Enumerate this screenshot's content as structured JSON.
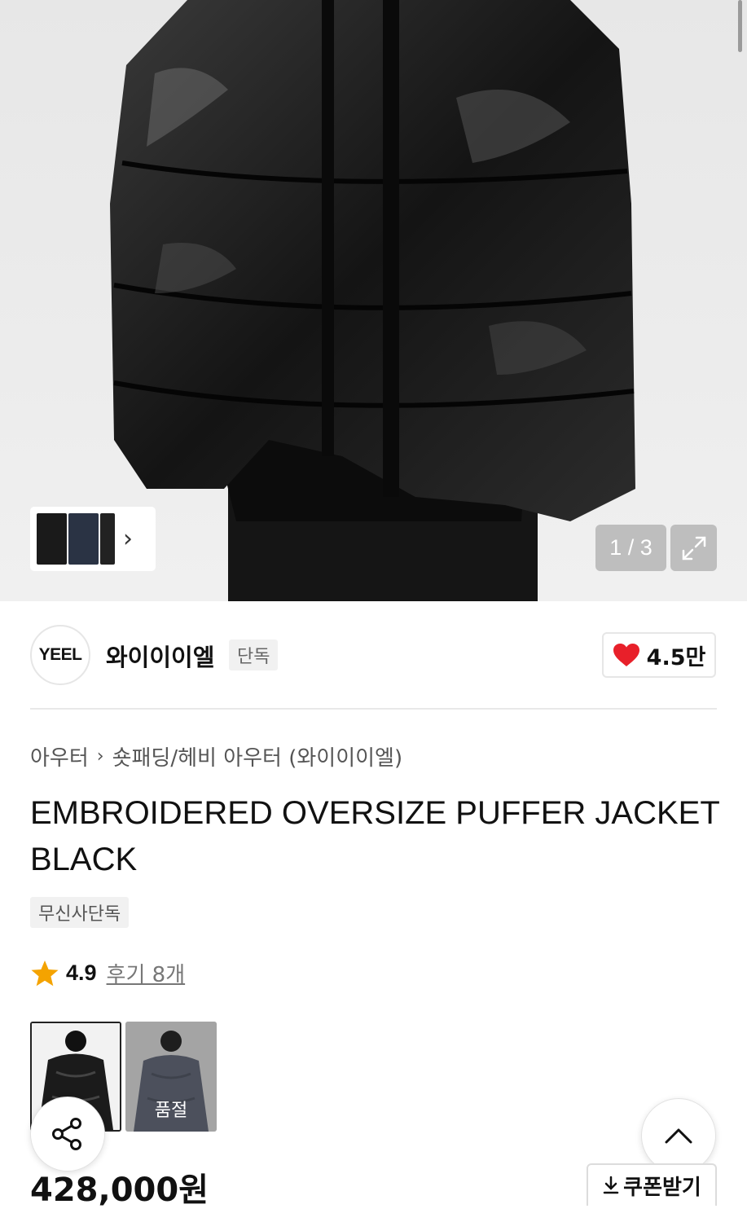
{
  "gallery": {
    "counter": "1 / 3",
    "thumbnail_colors": [
      "#1a1a1a",
      "#2a3344",
      "#222222"
    ]
  },
  "brand": {
    "logo_text": "YEEL",
    "name": "와이이이엘",
    "badge": "단독",
    "likes": "4.5만",
    "like_color": "#e8202a"
  },
  "breadcrumb": {
    "category": "아우터",
    "subcategory": "숏패딩/헤비 아우터 (와이이이엘)"
  },
  "product": {
    "title": "EMBROIDERED OVERSIZE PUFFER JACKET BLACK",
    "tag": "무신사단독",
    "rating": "4.9",
    "reviews_label": "후기 8개",
    "star_color": "#f4a300",
    "price": "428,000원"
  },
  "options": [
    {
      "color": "black",
      "selected": true
    },
    {
      "color": "grey",
      "status_label": "품절"
    }
  ],
  "actions": {
    "coupon_label": "쿠폰받기"
  }
}
